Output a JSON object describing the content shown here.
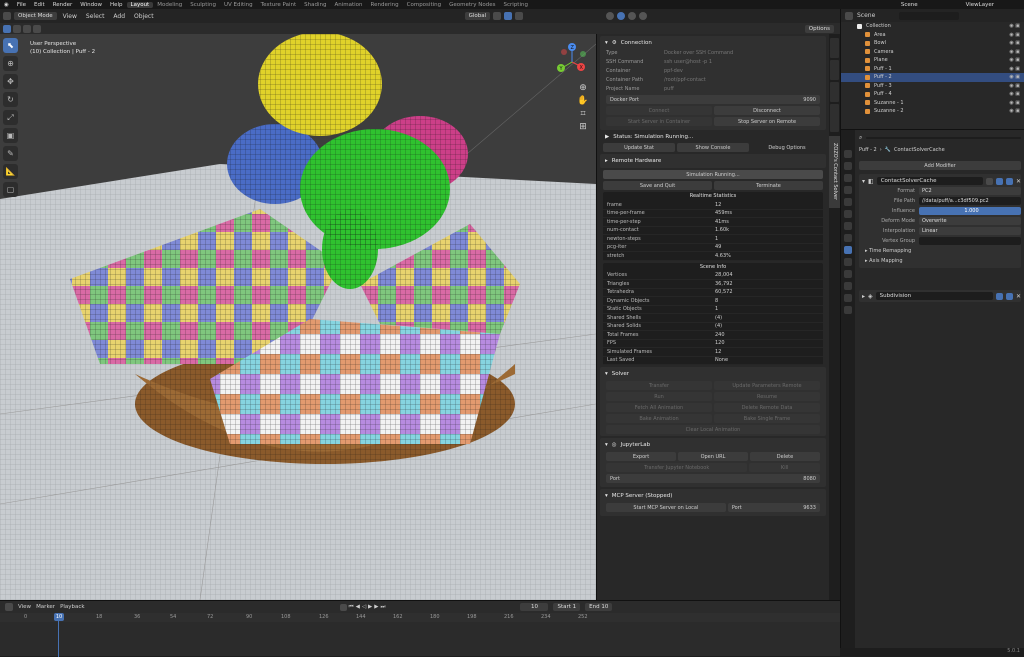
{
  "topbar": {
    "menus": [
      "File",
      "Edit",
      "Render",
      "Window",
      "Help"
    ],
    "workspaces": [
      "Layout",
      "Modeling",
      "Sculpting",
      "UV Editing",
      "Texture Paint",
      "Shading",
      "Animation",
      "Rendering",
      "Compositing",
      "Geometry Nodes",
      "Scripting"
    ],
    "active": "Layout",
    "scene": "Scene",
    "view_layer": "ViewLayer"
  },
  "header": {
    "mode": "Object Mode",
    "menus": [
      "View",
      "Select",
      "Add",
      "Object"
    ],
    "orientation": "Global",
    "options": "Options"
  },
  "viewport": {
    "perspective": "User Perspective",
    "collection": "(10) Collection | Puff - 2",
    "gizmo": {
      "x": "X",
      "y": "Y",
      "z": "Z"
    }
  },
  "panel": {
    "tab_label": "ZOZO's Contact Solver",
    "connection": {
      "title": "Connection",
      "rows": [
        [
          "Type",
          "Docker over SSH Command"
        ],
        [
          "SSH Command",
          "ssh user@host -p 1"
        ],
        [
          "Container",
          "ppf-dev"
        ],
        [
          "Container Path",
          "/root/ppf-contact"
        ],
        [
          "Project Name",
          "puff"
        ]
      ],
      "docker_port_label": "Docker Port",
      "docker_port": "9090",
      "connect": "Connect",
      "disconnect": "Disconnect",
      "start_server": "Start Server in Container",
      "stop_server": "Stop Server on Remote"
    },
    "status": {
      "label": "Status: Simulation Running...",
      "update": "Update Stat",
      "show_console": "Show Console",
      "debug": "Debug Options"
    },
    "remote": {
      "label": "Remote Hardware"
    },
    "sim": {
      "running": "Simulation Running...",
      "save_quit": "Save and Quit",
      "terminate": "Terminate"
    },
    "realtime": {
      "title": "Realtime Statistics",
      "rows": [
        [
          "frame",
          "12"
        ],
        [
          "time-per-frame",
          "459ms"
        ],
        [
          "time-per-step",
          "41ms"
        ],
        [
          "num-contact",
          "1.60k"
        ],
        [
          "newton-steps",
          "1"
        ],
        [
          "pcg-iter",
          "49"
        ],
        [
          "stretch",
          "4.63%"
        ]
      ]
    },
    "scene": {
      "title": "Scene Info",
      "rows": [
        [
          "Vertices",
          "28,004"
        ],
        [
          "Triangles",
          "36,792"
        ],
        [
          "Tetrahedra",
          "60,572"
        ],
        [
          "Dynamic Objects",
          "8"
        ],
        [
          "Static Objects",
          "1"
        ],
        [
          "Shared Shells",
          "(4)"
        ],
        [
          "Shared Solids",
          "(4)"
        ],
        [
          "Total Frames",
          "240"
        ],
        [
          "FPS",
          "120"
        ],
        [
          "Simulated Frames",
          "12"
        ],
        [
          "Last Saved",
          "None"
        ]
      ]
    },
    "solver": {
      "title": "Solver",
      "buttons": [
        "Transfer",
        "Update Parameters Remote",
        "Run",
        "Resume",
        "Fetch All Animation",
        "Delete Remote Data",
        "Bake Animation",
        "Bake Single Frame",
        "Clear Local Animation"
      ]
    },
    "jupyter": {
      "title": "JupyterLab",
      "export": "Export",
      "open": "Open URL",
      "delete": "Delete",
      "transfer": "Transfer Jupyter Notebook",
      "kill": "Kill",
      "port_label": "Port",
      "port": "8080"
    },
    "mcp": {
      "title": "MCP Server (Stopped)",
      "start": "Start MCP Server on Local",
      "port_label": "Port",
      "port": "9633"
    }
  },
  "timeline": {
    "menus": [
      "View",
      "Marker",
      "Playback"
    ],
    "current": "10",
    "start_label": "Start",
    "start": "1",
    "end_label": "End",
    "end": "10",
    "ticks": [
      "0",
      "18",
      "36",
      "54",
      "72",
      "90",
      "108",
      "126",
      "144",
      "162",
      "180",
      "198",
      "216",
      "234",
      "252"
    ],
    "playhead": "10"
  },
  "outliner": {
    "root": "Collection",
    "items": [
      "Area",
      "Bowl",
      "Camera",
      "Plane",
      "Puff - 1",
      "Puff - 2",
      "Puff - 3",
      "Puff - 4",
      "Suzanne - 1",
      "Suzanne - 2"
    ]
  },
  "properties": {
    "object": "Puff - 2",
    "modifier_stack": "ContactSolverCache",
    "add_modifier": "Add Modifier",
    "cache": {
      "name": "ContactSolverCache",
      "rows": [
        [
          "Format",
          "PC2"
        ],
        [
          "File Path",
          "//data/puff/a...c3df509.pc2"
        ],
        [
          "Influence",
          "1.000"
        ],
        [
          "Deform Mode",
          "Overwrite"
        ],
        [
          "Interpolation",
          "Linear"
        ],
        [
          "Vertex Group",
          ""
        ]
      ],
      "time_remap": "Time Remapping",
      "axis_map": "Axis Mapping"
    },
    "subdivision": "Subdivision"
  },
  "status": {
    "version": "5.0.1"
  }
}
